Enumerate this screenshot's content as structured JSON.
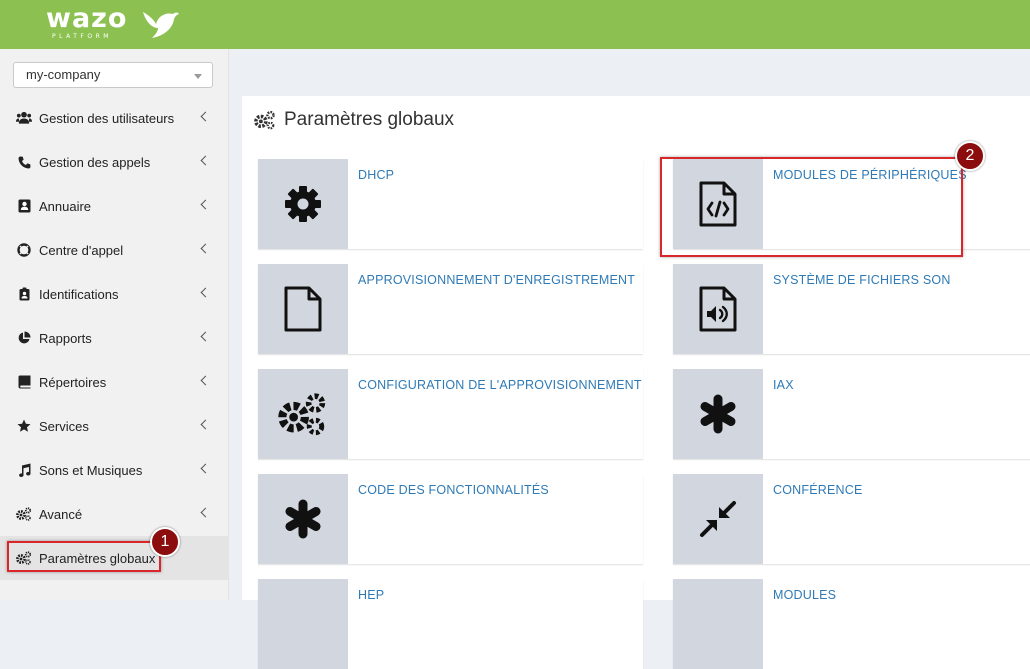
{
  "header": {
    "logo_text": "wazo",
    "logo_subtext": "PLATFORM"
  },
  "sidebar": {
    "company_select": {
      "value": "my-company"
    },
    "items": [
      {
        "label": "Gestion des utilisateurs",
        "icon": "users-icon"
      },
      {
        "label": "Gestion des appels",
        "icon": "phone-icon"
      },
      {
        "label": "Annuaire",
        "icon": "address-book-icon"
      },
      {
        "label": "Centre d'appel",
        "icon": "lifebuoy-icon"
      },
      {
        "label": "Identifications",
        "icon": "id-badge-icon"
      },
      {
        "label": "Rapports",
        "icon": "pie-chart-icon"
      },
      {
        "label": "Répertoires",
        "icon": "book-icon"
      },
      {
        "label": "Services",
        "icon": "star-icon"
      },
      {
        "label": "Sons et Musiques",
        "icon": "music-icon"
      },
      {
        "label": "Avancé",
        "icon": "cogs-icon"
      },
      {
        "label": "Paramètres globaux",
        "icon": "cogs-icon",
        "active": true
      }
    ]
  },
  "main": {
    "title": "Paramètres globaux",
    "tiles": [
      {
        "label": "DHCP",
        "icon": "gear-icon"
      },
      {
        "label": "MODULES DE PÉRIPHÉRIQUES",
        "icon": "file-code-icon"
      },
      {
        "label": "APPROVISIONNEMENT D'ENREGISTREMENT",
        "icon": "file-icon"
      },
      {
        "label": "SYSTÈME DE FICHIERS SON",
        "icon": "file-audio-icon"
      },
      {
        "label": "CONFIGURATION DE L'APPROVISIONNEMENT",
        "icon": "cogs-icon"
      },
      {
        "label": "IAX",
        "icon": "asterisk-icon"
      },
      {
        "label": "CODE DES FONCTIONNALITÉS",
        "icon": "asterisk-icon"
      },
      {
        "label": "CONFÉRENCE",
        "icon": "compress-icon"
      },
      {
        "label": "HEP",
        "icon": "file-icon"
      },
      {
        "label": "MODULES",
        "icon": "file-icon"
      }
    ]
  },
  "annotations": {
    "badge_1": "1",
    "badge_2": "2"
  },
  "colors": {
    "header": "#8cc152",
    "link": "#2f7ab5",
    "tile_box": "#d2d6de",
    "callout": "#d9262b",
    "badge": "#8b0d0d"
  }
}
